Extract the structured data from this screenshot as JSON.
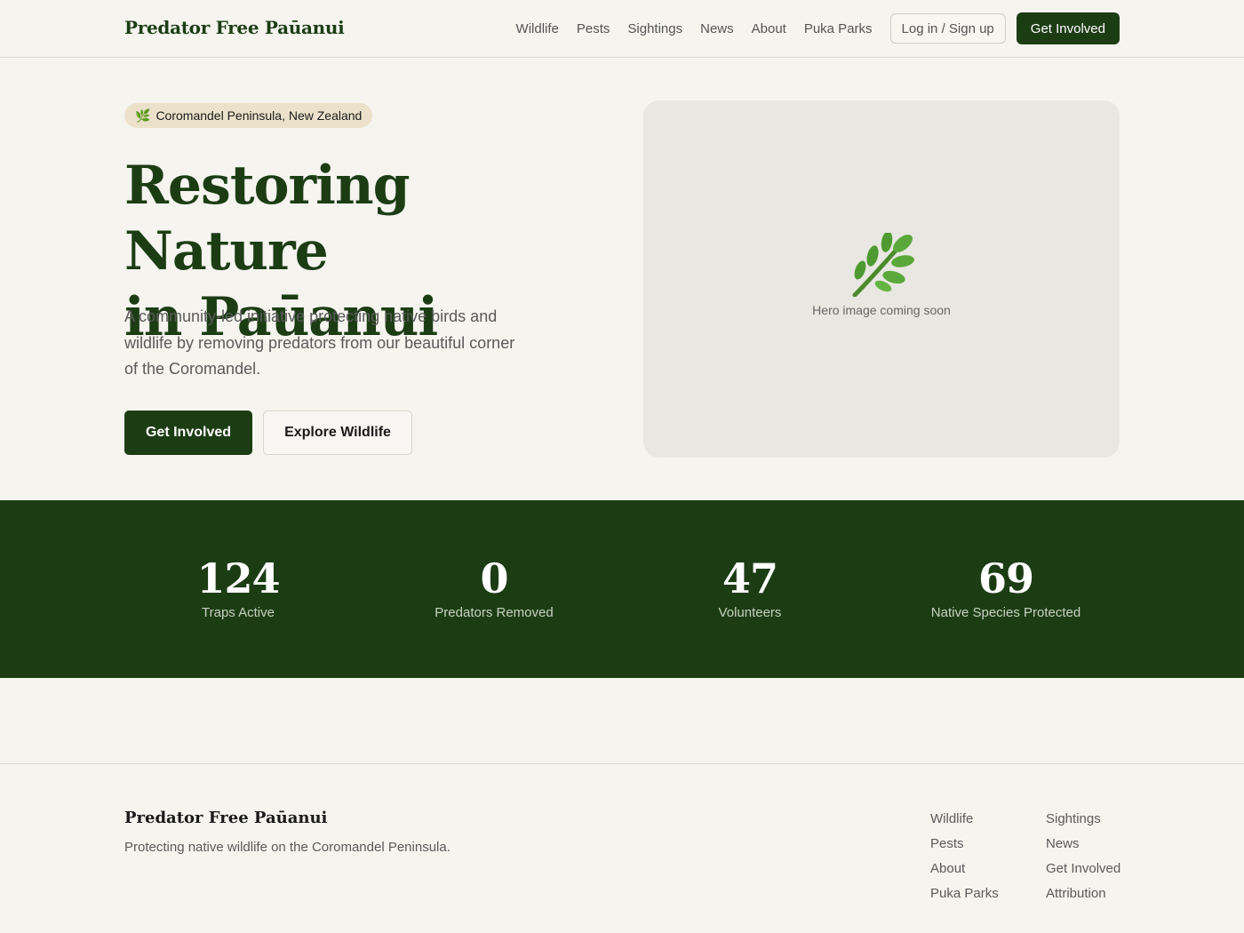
{
  "header": {
    "brand": "Predator Free Paūanui",
    "nav": [
      "Wildlife",
      "Pests",
      "Sightings",
      "News",
      "About",
      "Puka Parks"
    ],
    "login_label": "Log in / Sign up",
    "cta_label": "Get Involved"
  },
  "hero": {
    "badge_icon": "leaf-icon",
    "badge_text": "Coromandel Peninsula, New Zealand",
    "title_line1": "Restoring Nature",
    "title_line2": "in Paūanui",
    "description": "A community-led initiative protecting native birds and wildlife by removing predators from our beautiful corner of the Coromandel.",
    "primary_button": "Get Involved",
    "secondary_button": "Explore Wildlife",
    "image_icon": "leaf-icon",
    "image_caption": "Hero image coming soon"
  },
  "stats": [
    {
      "value": "124",
      "label": "Traps Active"
    },
    {
      "value": "0",
      "label": "Predators Removed"
    },
    {
      "value": "47",
      "label": "Volunteers"
    },
    {
      "value": "69",
      "label": "Native Species Protected"
    }
  ],
  "footer": {
    "brand": "Predator Free Paūanui",
    "tagline": "Protecting native wildlife on the Coromandel Peninsula.",
    "col1": [
      "Wildlife",
      "Pests",
      "About",
      "Puka Parks"
    ],
    "col2": [
      "Sightings",
      "News",
      "Get Involved",
      "Attribution"
    ]
  },
  "colors": {
    "brand_green": "#1c3d14",
    "background": "#f5f4ef",
    "badge_bg": "#ece2cb"
  }
}
